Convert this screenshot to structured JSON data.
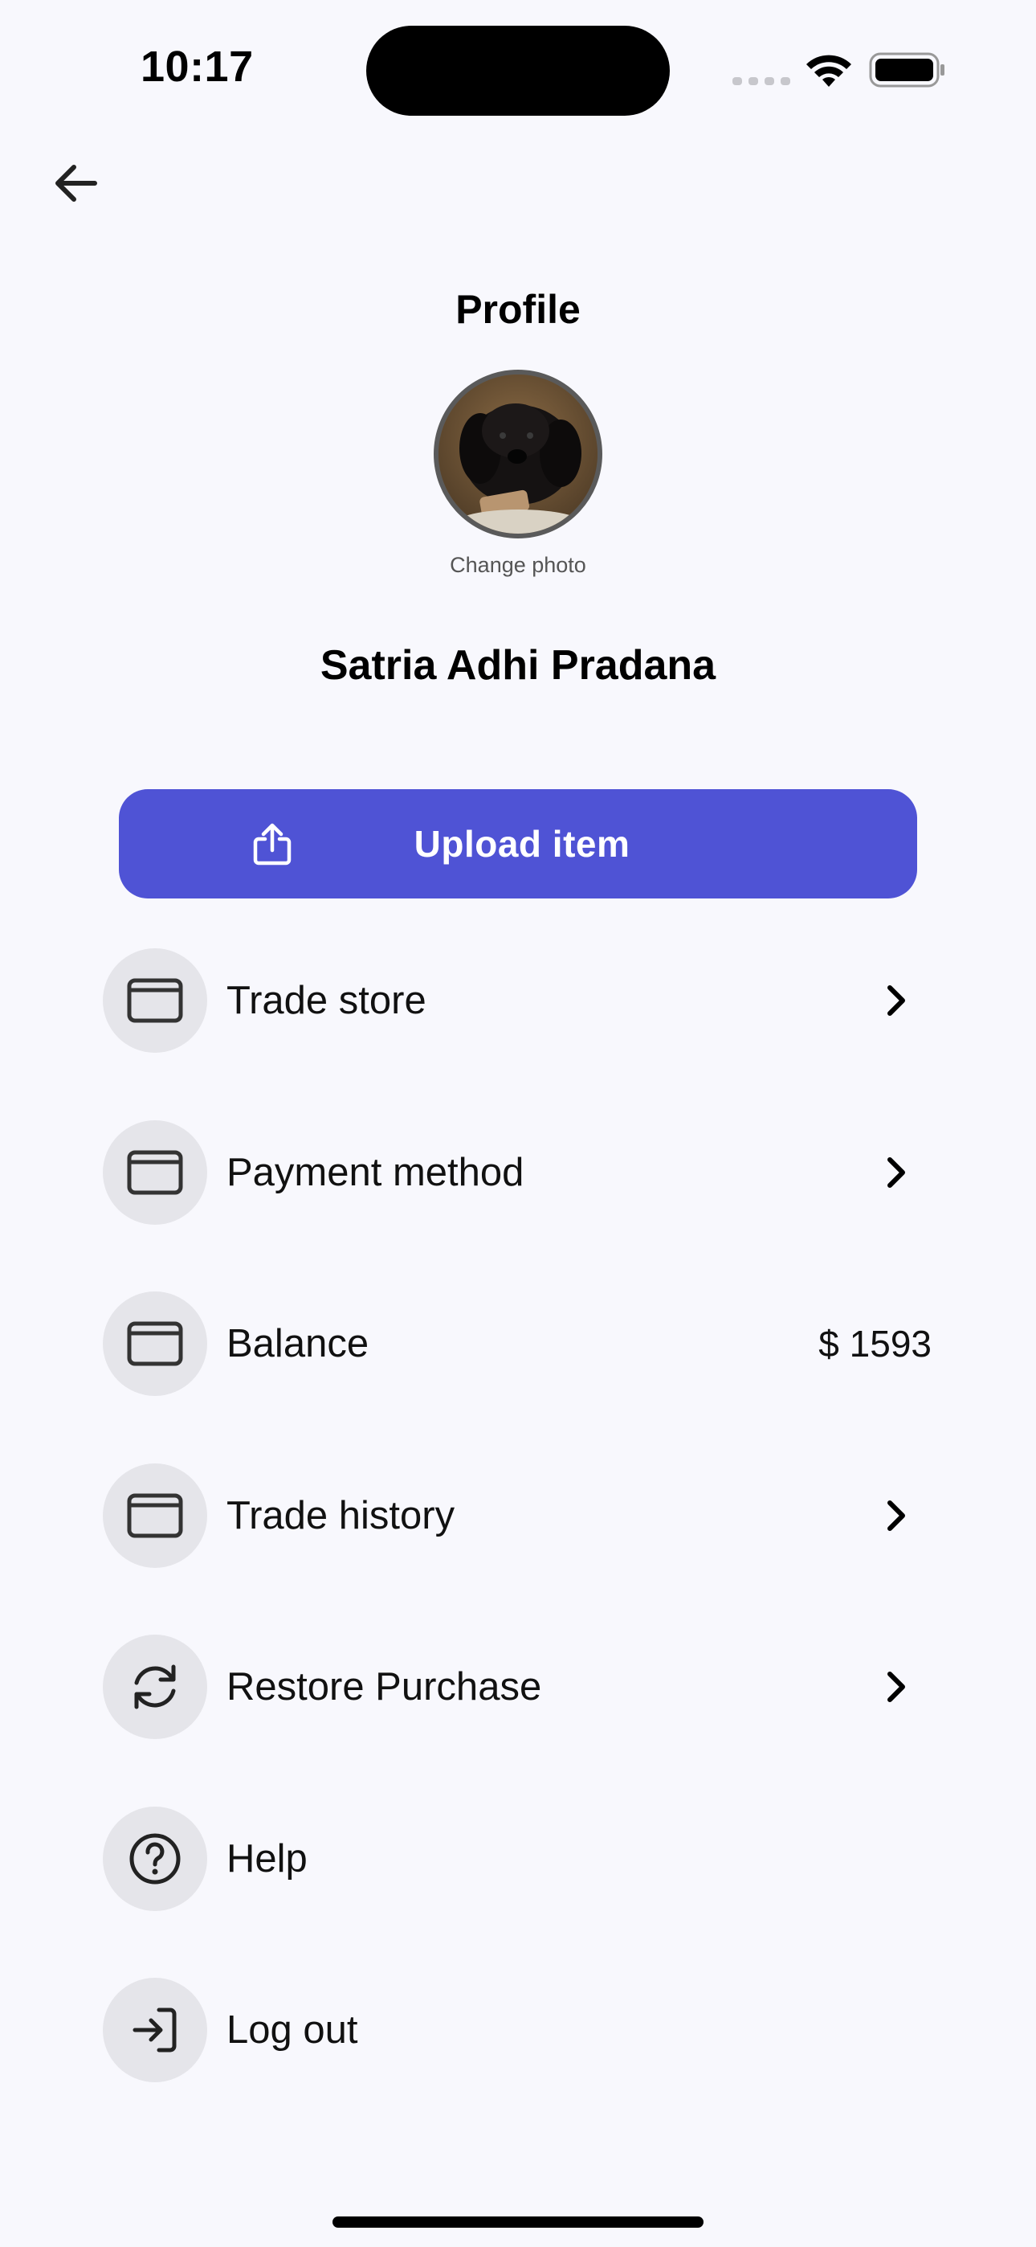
{
  "status_bar": {
    "time": "10:17",
    "icons": [
      "signal-icon",
      "wifi-icon",
      "battery-icon"
    ]
  },
  "header": {
    "back_icon": "arrow-left-icon",
    "title": "Profile"
  },
  "profile": {
    "change_photo_label": "Change photo",
    "name": "Satria Adhi Pradana"
  },
  "upload": {
    "label": "Upload item",
    "icon": "share-upload-icon",
    "color": "#4F53D5"
  },
  "menu": {
    "items": [
      {
        "label": "Trade store",
        "icon": "card-icon",
        "trailing": "chevron-right-icon"
      },
      {
        "label": "Payment method",
        "icon": "card-icon",
        "trailing": "chevron-right-icon"
      },
      {
        "label": "Balance",
        "icon": "card-icon",
        "value": "$ 1593"
      },
      {
        "label": "Trade history",
        "icon": "card-icon",
        "trailing": "chevron-right-icon"
      },
      {
        "label": "Restore Purchase",
        "icon": "refresh-icon",
        "trailing": "chevron-right-icon"
      },
      {
        "label": "Help",
        "icon": "question-circle-icon"
      },
      {
        "label": "Log out",
        "icon": "logout-icon"
      }
    ]
  },
  "colors": {
    "background": "#F8F8FD",
    "accent": "#4F53D5",
    "icon_circle": "#E5E5EA"
  }
}
